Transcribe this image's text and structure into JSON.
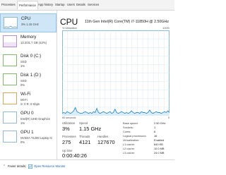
{
  "tabs": [
    "Processes",
    "Performance",
    "App history",
    "Startup",
    "Users",
    "Details",
    "Services"
  ],
  "sidebar": [
    {
      "title": "CPU",
      "sub1": "3%  1.15 GHz",
      "sub2": ""
    },
    {
      "title": "Memory",
      "sub1": "13.2/31.7 GB (42%)",
      "sub2": ""
    },
    {
      "title": "Disk 0 (C:)",
      "sub1": "SSD",
      "sub2": "1%"
    },
    {
      "title": "Disk 1 (D:)",
      "sub1": "SSD",
      "sub2": "0%"
    },
    {
      "title": "Wi-Fi",
      "sub1": "Wi-Fi",
      "sub2": "S: 0  R: 0 Kbps"
    },
    {
      "title": "GPU 0",
      "sub1": "Intel(R) UHD Graphics",
      "sub2": "1%"
    },
    {
      "title": "GPU 1",
      "sub1": "NVIDIA T1200 Laptop G",
      "sub2": "0%"
    }
  ],
  "main": {
    "title": "CPU",
    "model": "11th Gen Intel(R) Core(TM) i7-11850H @ 2.50GHz",
    "graph_top": "% Utilization",
    "graph_top_right": "100%",
    "graph_bottom_left": "60 seconds",
    "graph_bottom_right": "0",
    "stats": {
      "utilization_label": "Utilization",
      "utilization_value": "3%",
      "speed_label": "Speed",
      "speed_value": "1.15 GHz",
      "processes_label": "Processes",
      "processes_value": "275",
      "threads_label": "Threads",
      "threads_value": "4121",
      "handles_label": "Handles",
      "handles_value": "127670",
      "uptime_label": "Up time",
      "uptime_value": "0:00:40:26"
    },
    "specs": [
      {
        "k": "Base speed:",
        "v": "2.50 GHz"
      },
      {
        "k": "Sockets:",
        "v": "1"
      },
      {
        "k": "Cores:",
        "v": "8"
      },
      {
        "k": "Logical processors:",
        "v": "16"
      },
      {
        "k": "Virtualization:",
        "v": "Enabled"
      },
      {
        "k": "L1 cache:",
        "v": "640 KB"
      },
      {
        "k": "L2 cache:",
        "v": "10.0 MB"
      },
      {
        "k": "L3 cache:",
        "v": "24.0 MB"
      }
    ]
  },
  "footer": {
    "fewer_details": "Fewer details",
    "open_resource_monitor": "Open Resource Monitor"
  },
  "colors": {
    "accent": "#1a7fc1",
    "graph_fill": "#d9ecf8",
    "graph_border": "#6aa9d6",
    "grid": "#cfe3f2"
  },
  "cpu_history_percent": [
    2,
    3,
    2,
    4,
    3,
    2,
    3,
    5,
    9,
    4,
    3,
    2,
    2,
    3,
    4,
    3,
    2,
    3,
    2,
    4,
    3,
    8,
    3,
    2,
    3,
    4,
    3,
    2,
    3,
    4,
    2,
    3,
    7,
    3,
    2,
    3,
    4,
    3,
    2,
    3,
    2,
    3,
    5,
    3,
    2,
    3,
    3,
    2,
    4,
    3,
    3,
    2,
    3,
    6,
    3,
    2,
    3,
    4,
    3,
    3,
    2,
    3,
    4,
    3,
    5,
    3
  ]
}
